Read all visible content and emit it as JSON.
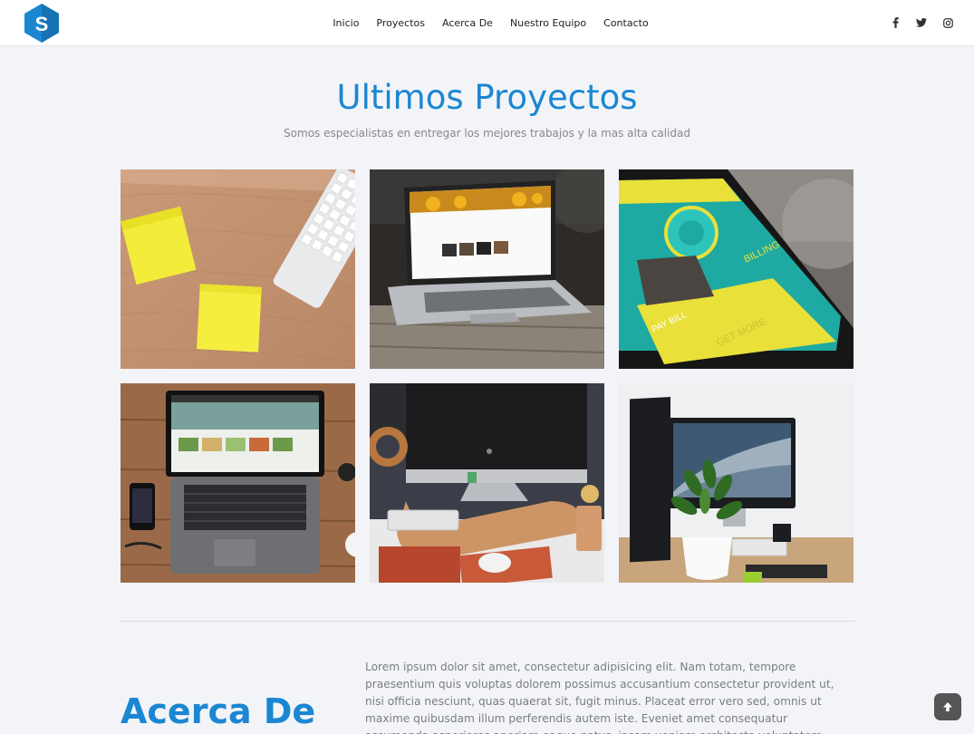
{
  "nav": {
    "items": [
      "Inicio",
      "Proyectos",
      "Acerca De",
      "Nuestro Equipo",
      "Contacto"
    ]
  },
  "logo": {
    "letter": "S",
    "color": "#1b87d2"
  },
  "social": {
    "icons": [
      "facebook-icon",
      "twitter-icon",
      "instagram-icon"
    ]
  },
  "projects": {
    "title": "Ultimos Proyectos",
    "subtitle": "Somos especialistas en entregar los mejores trabajos y la mas alta calidad",
    "images": [
      "sticky-notes-desk-photo",
      "laptop-desk-photo",
      "smartphone-billing-app-photo",
      "laptop-website-photo",
      "imac-workspace-photo",
      "imac-plant-desk-photo"
    ],
    "phone_labels": [
      "BILLING",
      "PAY BILL",
      "GET MORE"
    ]
  },
  "about": {
    "title": "Acerca De",
    "text": "Lorem ipsum dolor sit amet, consectetur adipisicing elit. Nam totam, tempore praesentium quis voluptas dolorem possimus accusantium consectetur provident ut, nisi officia nesciunt, quas quaerat sit, fugit minus. Placeat error vero sed, omnis ut maxime quibusdam illum perferendis autem iste. Eveniet amet consequatur assumenda asperiores aperiam eaque natus, ipsam veniam architecto voluptatem tempora sit."
  },
  "colors": {
    "accent": "#1b87d2",
    "background": "#f3f4f8"
  }
}
